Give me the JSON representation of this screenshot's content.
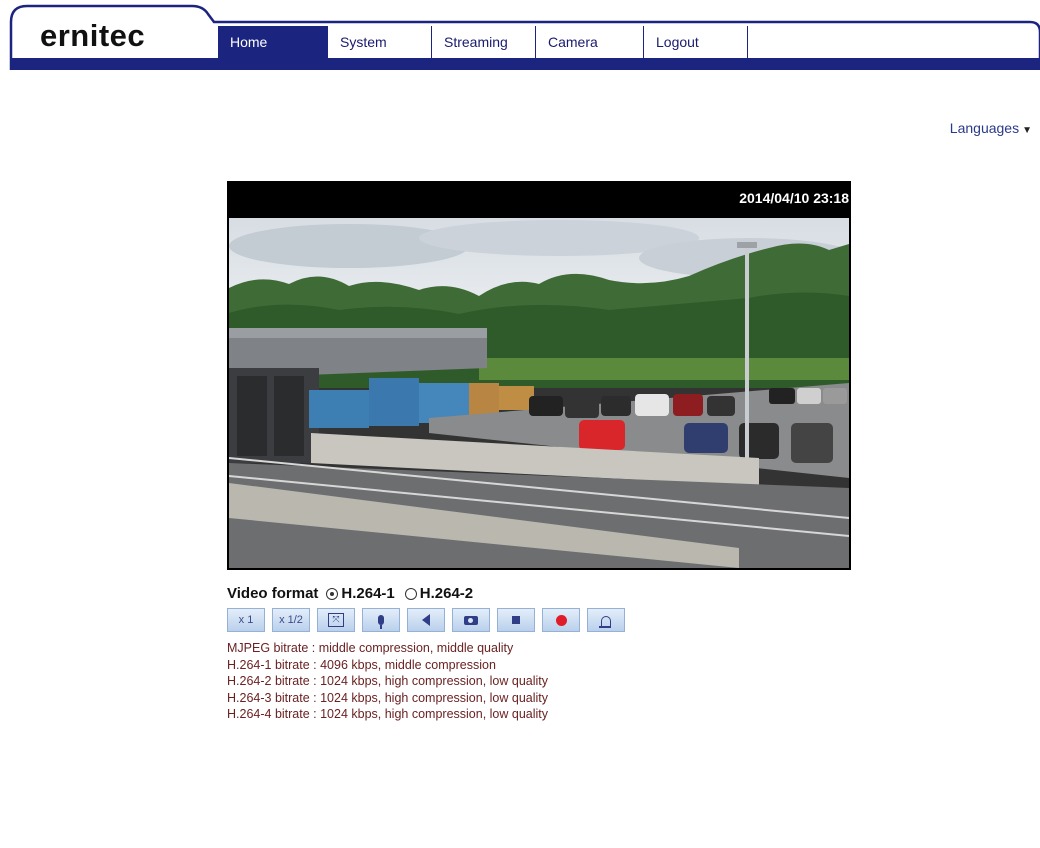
{
  "header": {
    "logo": "ernitec",
    "nav": [
      {
        "label": "Home",
        "active": true
      },
      {
        "label": "System",
        "active": false
      },
      {
        "label": "Streaming",
        "active": false
      },
      {
        "label": "Camera",
        "active": false
      },
      {
        "label": "Logout",
        "active": false
      }
    ],
    "accent_color": "#1b2580"
  },
  "languages": {
    "label": "Languages"
  },
  "video": {
    "timestamp": "2014/04/10 23:18"
  },
  "video_format": {
    "label": "Video format",
    "options": [
      {
        "label": "H.264-1",
        "selected": true
      },
      {
        "label": "H.264-2",
        "selected": false
      }
    ]
  },
  "toolbar": {
    "buttons": [
      {
        "name": "zoom-x1",
        "text": "x 1"
      },
      {
        "name": "zoom-half",
        "text": "x 1/2"
      },
      {
        "name": "fit-screen",
        "icon": "fit-screen-icon"
      },
      {
        "name": "microphone",
        "icon": "microphone-icon"
      },
      {
        "name": "speaker",
        "icon": "speaker-icon"
      },
      {
        "name": "snapshot",
        "icon": "camera-icon"
      },
      {
        "name": "stop",
        "icon": "stop-icon"
      },
      {
        "name": "record",
        "icon": "record-icon"
      },
      {
        "name": "alarm",
        "icon": "bell-icon"
      }
    ]
  },
  "bitrate_info": [
    "MJPEG bitrate : middle compression, middle quality",
    "H.264-1 bitrate : 4096 kbps, middle compression",
    "H.264-2 bitrate : 1024 kbps, high compression, low quality",
    "H.264-3 bitrate : 1024 kbps, high compression, low quality",
    "H.264-4 bitrate : 1024 kbps, high compression, low quality"
  ]
}
